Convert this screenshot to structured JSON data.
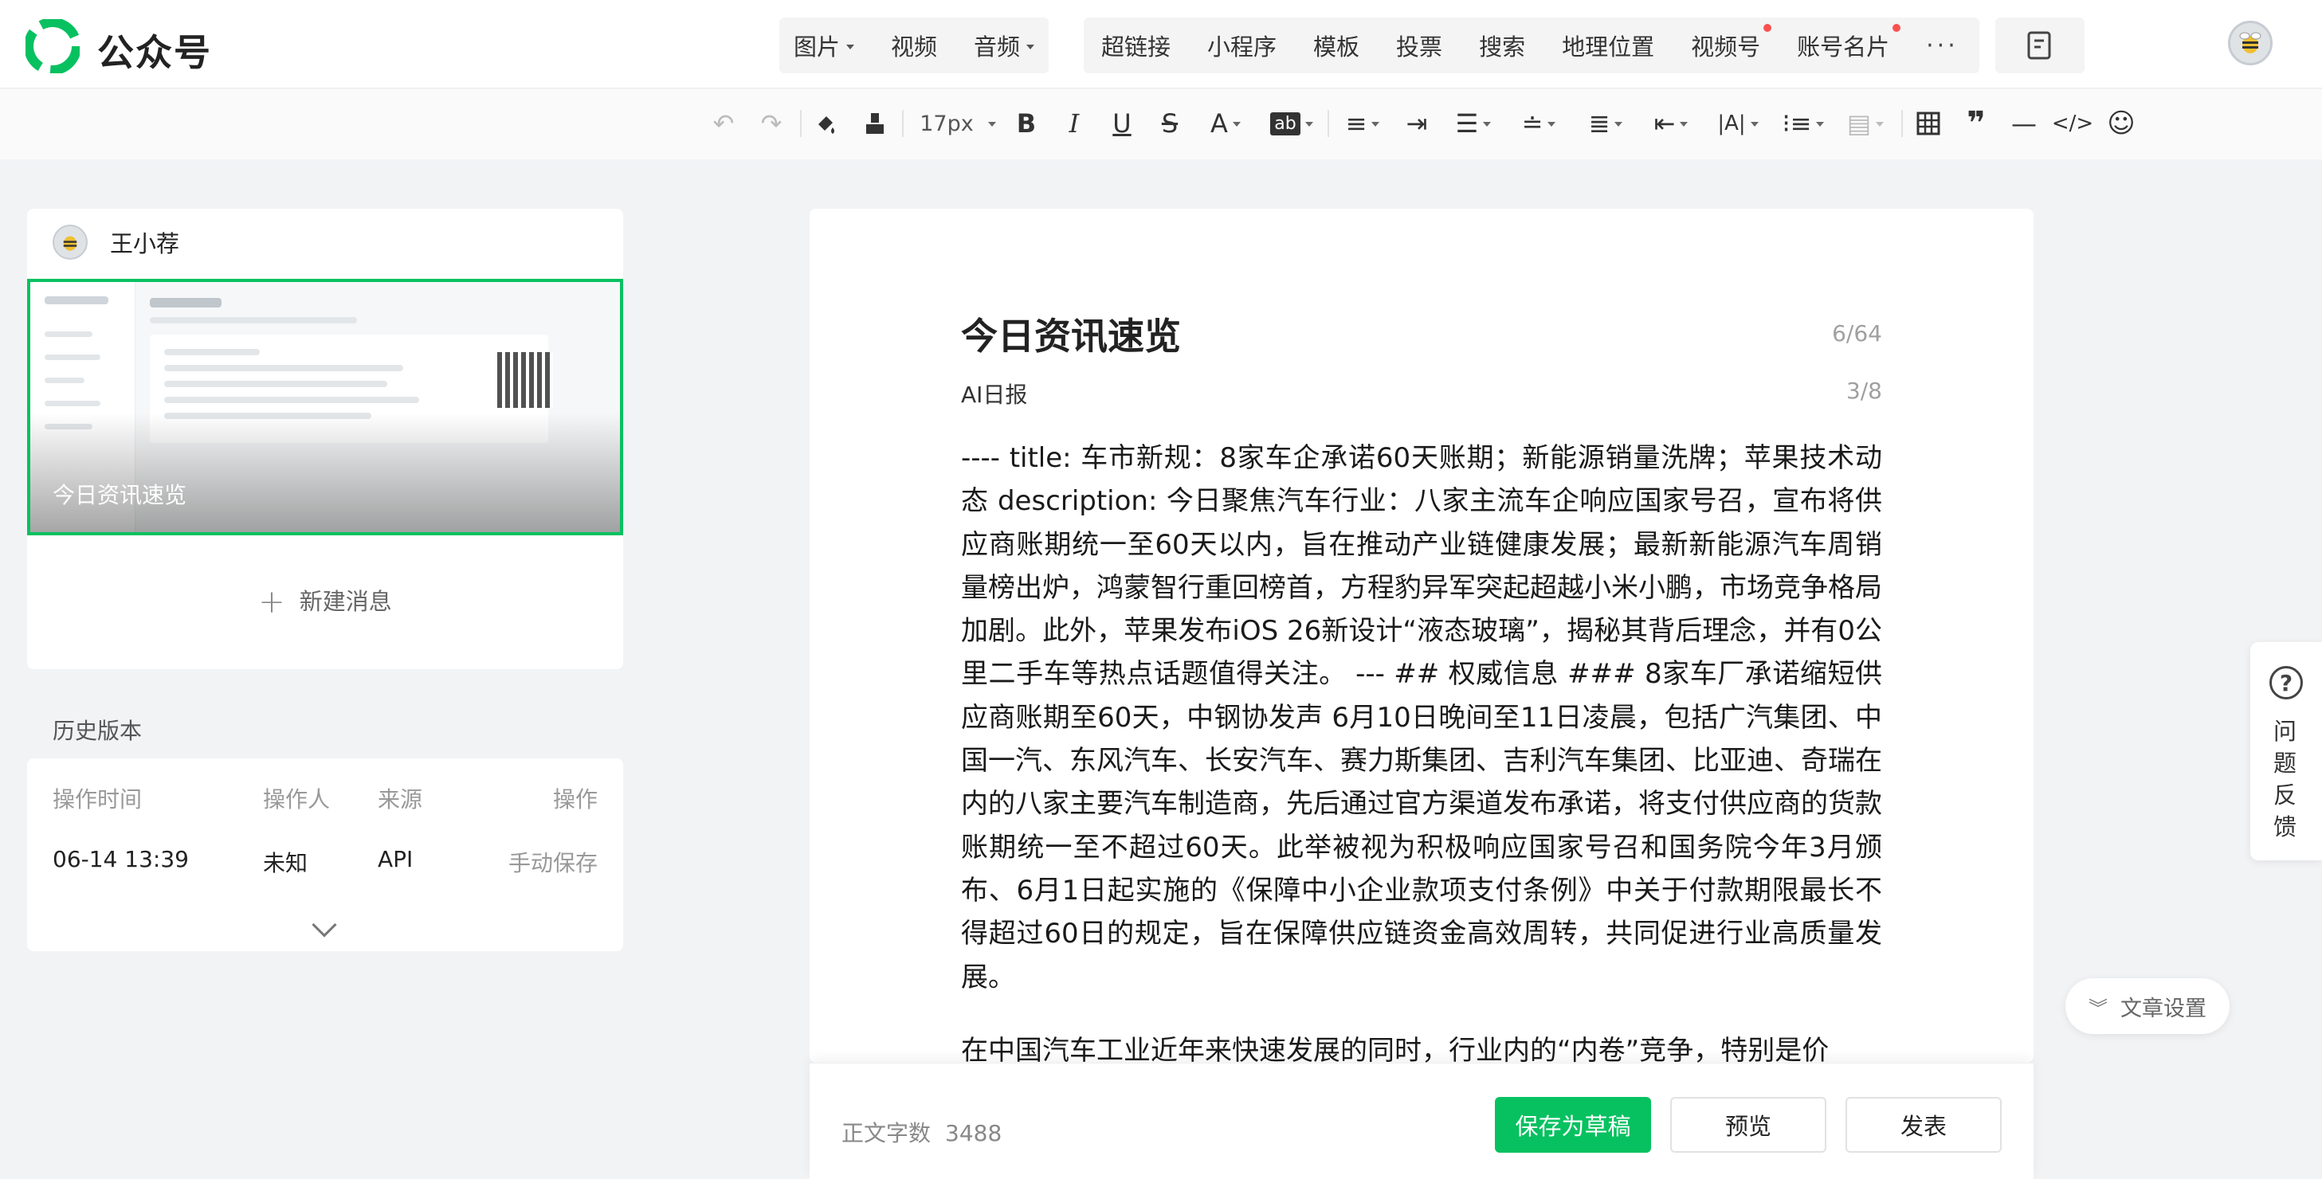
{
  "header": {
    "brand": "公众号",
    "media_buttons": [
      "图片",
      "视频",
      "音频"
    ],
    "insert_buttons": [
      "超链接",
      "小程序",
      "模板",
      "投票",
      "搜索",
      "地理位置",
      "视频号",
      "账号名片"
    ],
    "more": "···"
  },
  "toolbar": {
    "font_size": "17px",
    "icons": [
      "undo-icon",
      "redo-icon",
      "format-painter-icon",
      "clear-format-icon",
      "bold-icon",
      "italic-icon",
      "underline-icon",
      "strikethrough-icon",
      "font-color-icon",
      "background-color-icon",
      "align-icon",
      "indent-icon",
      "margin-icon",
      "line-height-icon",
      "paragraph-spacing-icon",
      "text-indent-icon",
      "letter-spacing-icon",
      "list-icon",
      "image-align-icon",
      "table-icon",
      "quote-icon",
      "divider-icon",
      "code-icon",
      "emoji-icon"
    ]
  },
  "account": {
    "name": "王小荐",
    "thumbnail_title": "今日资讯速览",
    "new_message": "新建消息"
  },
  "history": {
    "title": "历史版本",
    "columns": [
      "操作时间",
      "操作人",
      "来源",
      "操作"
    ],
    "rows": [
      {
        "time": "06-14 13:39",
        "user": "未知",
        "source": "API",
        "action": "手动保存"
      }
    ]
  },
  "article": {
    "title": "今日资讯速览",
    "title_count": "6/64",
    "author": "AI日报",
    "author_count": "3/8",
    "paragraphs": [
      "---- title: 车市新规：8家车企承诺60天账期；新能源销量洗牌；苹果技术动态 description: 今日聚焦汽车行业：八家主流车企响应国家号召，宣布将供应商账期统一至60天以内，旨在推动产业链健康发展；最新新能源汽车周销量榜出炉，鸿蒙智行重回榜首，方程豹异军突起超越小米小鹏，市场竞争格局加剧。此外，苹果发布iOS 26新设计“液态玻璃”，揭秘其背后理念，并有0公里二手车等热点话题值得关注。 --- ## 权威信息 ### 8家车厂承诺缩短供应商账期至60天，中钢协发声  6月10日晚间至11日凌晨，包括广汽集团、中国一汽、东风汽车、长安汽车、赛力斯集团、吉利汽车集团、比亚迪、奇瑞在内的八家主要汽车制造商，先后通过官方渠道发布承诺，将支付供应商的货款账期统一至不超过60天。此举被视为积极响应国家号召和国务院今年3月颁布、6月1日起实施的《保障中小企业款项支付条例》中关于付款期限最长不得超过60日的规定，旨在保障供应链资金高效周转，共同促进行业高质量发展。",
      "在中国汽车工业近年来快速发展的同时，行业内的“内卷”竞争，特别是价"
    ]
  },
  "footer": {
    "word_count_label": "正文字数",
    "word_count": "3488",
    "save_draft": "保存为草稿",
    "preview": "预览",
    "publish": "发表"
  },
  "floating": {
    "feedback": "问题反馈",
    "settings": "文章设置"
  },
  "colors": {
    "accent": "#07c160",
    "badge": "#fa5151"
  }
}
